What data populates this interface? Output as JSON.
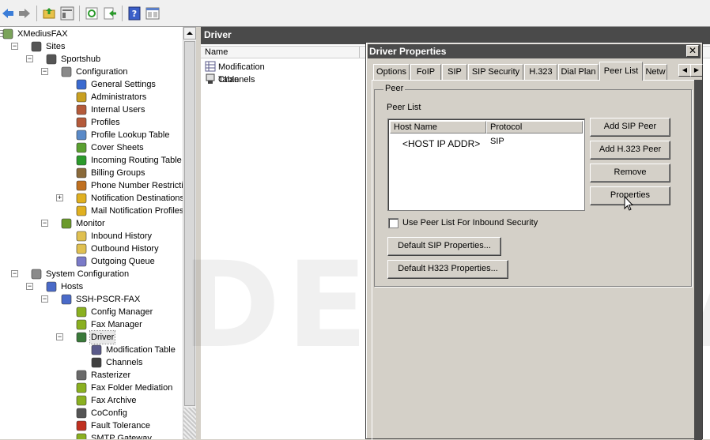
{
  "toolbar": {
    "buttons": [
      "back-icon",
      "forward-icon",
      "up-folder-icon",
      "show-hide-tree-icon",
      "refresh-icon",
      "export-icon",
      "help-icon",
      "properties-icon"
    ]
  },
  "tree": [
    {
      "label": "XMediusFAX",
      "icon": "server-icon"
    },
    {
      "label": "Sites",
      "icon": "sites-icon"
    },
    {
      "label": "Sportshub",
      "icon": "site-icon"
    },
    {
      "label": "Configuration",
      "icon": "gear-icon"
    },
    {
      "label": "General Settings",
      "icon": "settings-icon"
    },
    {
      "label": "Administrators",
      "icon": "administrators-icon"
    },
    {
      "label": "Internal Users",
      "icon": "users-icon"
    },
    {
      "label": "Profiles",
      "icon": "profiles-icon"
    },
    {
      "label": "Profile Lookup Table",
      "icon": "lookup-icon"
    },
    {
      "label": "Cover Sheets",
      "icon": "cover-sheets-icon"
    },
    {
      "label": "Incoming Routing Table",
      "icon": "routing-icon"
    },
    {
      "label": "Billing Groups",
      "icon": "billing-icon"
    },
    {
      "label": "Phone Number Restriction",
      "icon": "restriction-icon"
    },
    {
      "label": "Notification Destinations",
      "icon": "warning-icon"
    },
    {
      "label": "Mail Notification Profiles",
      "icon": "warning-icon"
    },
    {
      "label": "Monitor",
      "icon": "monitor-icon"
    },
    {
      "label": "Inbound History",
      "icon": "folder-history-icon"
    },
    {
      "label": "Outbound History",
      "icon": "folder-history-icon"
    },
    {
      "label": "Outgoing Queue",
      "icon": "queue-icon"
    },
    {
      "label": "System Configuration",
      "icon": "gear-icon"
    },
    {
      "label": "Hosts",
      "icon": "hosts-icon"
    },
    {
      "label": "SSH-PSCR-FAX",
      "icon": "host-icon"
    },
    {
      "label": "Config Manager",
      "icon": "cube-icon"
    },
    {
      "label": "Fax Manager",
      "icon": "cube-icon"
    },
    {
      "label": "Driver",
      "icon": "driver-icon"
    },
    {
      "label": "Modification Table",
      "icon": "table-icon"
    },
    {
      "label": "Channels",
      "icon": "channel-icon"
    },
    {
      "label": "Rasterizer",
      "icon": "rasterizer-icon"
    },
    {
      "label": "Fax Folder Mediation",
      "icon": "cube-icon"
    },
    {
      "label": "Fax Archive",
      "icon": "cube-icon"
    },
    {
      "label": "CoConfig",
      "icon": "site-icon"
    },
    {
      "label": "Fault Tolerance",
      "icon": "fault-tolerance-icon"
    },
    {
      "label": "SMTP Gateway",
      "icon": "cube-icon"
    }
  ],
  "right_pane": {
    "header": "Driver",
    "column": "Name",
    "items": [
      {
        "label": "Modification Table",
        "icon": "table-icon"
      },
      {
        "label": "Channels",
        "icon": "channel-icon"
      }
    ]
  },
  "watermark": "DEMO VE",
  "dialog": {
    "title": "Driver Properties",
    "close": "✕",
    "tabs": [
      "Options",
      "FoIP",
      "SIP",
      "SIP Security",
      "H.323",
      "Dial Plan",
      "Peer List",
      "Netw"
    ],
    "active_tab": "Peer List",
    "group_label": "Peer",
    "peer_list_label": "Peer List",
    "columns": [
      "Host Name",
      "Protocol"
    ],
    "rows": [
      {
        "host": "<HOST IP ADDR>",
        "protocol": "SIP"
      }
    ],
    "buttons": {
      "add_sip": "Add SIP Peer",
      "add_h323": "Add H.323 Peer",
      "remove": "Remove",
      "properties": "Properties",
      "default_sip": "Default SIP Properties...",
      "default_h323": "Default H323 Properties..."
    },
    "checkbox_label": "Use Peer List For Inbound Security",
    "checkbox_checked": false
  }
}
